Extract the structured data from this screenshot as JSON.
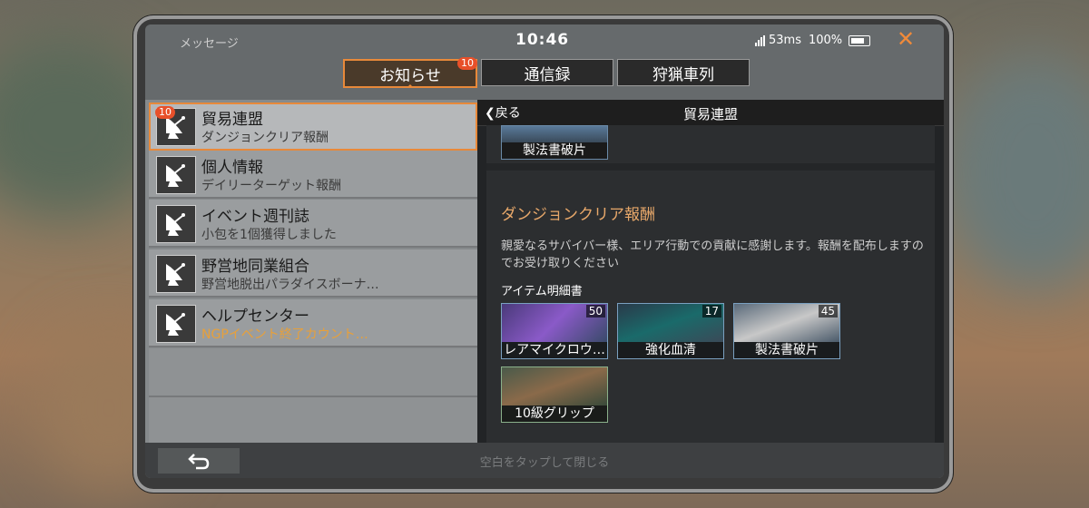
{
  "window": {
    "title": "メッセージ",
    "close_icon": "close-icon"
  },
  "status": {
    "time": "10:46",
    "ping": "53ms",
    "battery": "100%"
  },
  "tabs": [
    {
      "label": "お知らせ",
      "badge": "10",
      "active": true
    },
    {
      "label": "通信録",
      "badge": "",
      "active": false
    },
    {
      "label": "狩猟車列",
      "badge": "",
      "active": false
    }
  ],
  "list": [
    {
      "title": "貿易連盟",
      "subtitle": "ダンジョンクリア報酬",
      "badge": "10",
      "icon": "satellite-dish-icon"
    },
    {
      "title": "個人情報",
      "subtitle": "デイリーターゲット報酬",
      "badge": "",
      "icon": "satellite-dish-icon"
    },
    {
      "title": "イベント週刊誌",
      "subtitle": "小包を1個獲得しました",
      "badge": "",
      "icon": "satellite-dish-icon"
    },
    {
      "title": "野営地同業組合",
      "subtitle": "野営地脱出パラダイスボーナ…",
      "badge": "",
      "icon": "satellite-dish-icon"
    },
    {
      "title": "ヘルプセンター",
      "subtitle": "NGPイベント終了カウント…",
      "badge": "",
      "icon": "satellite-dish-icon"
    }
  ],
  "detail": {
    "back_label": "戻る",
    "header_title": "貿易連盟",
    "top_card_label": "製法書破片",
    "section_title": "ダンジョンクリア報酬",
    "message": "親愛なるサバイバー様、エリア行動での貢献に感謝します。報酬を配布しますのでお受け取りください",
    "items_label": "アイテム明細書",
    "items": [
      {
        "name": "レアマイクロウ…",
        "qty": "50"
      },
      {
        "name": "強化血清",
        "qty": "17"
      },
      {
        "name": "製法書破片",
        "qty": "45"
      },
      {
        "name": "10級グリップ",
        "qty": ""
      }
    ]
  },
  "footer": {
    "close_hint": "空白をタップして閉じる",
    "undo_icon": "return-arrow-icon"
  },
  "colors": {
    "accent": "#e8893a",
    "badge": "#e8502a",
    "section_title": "#e8a86a"
  }
}
